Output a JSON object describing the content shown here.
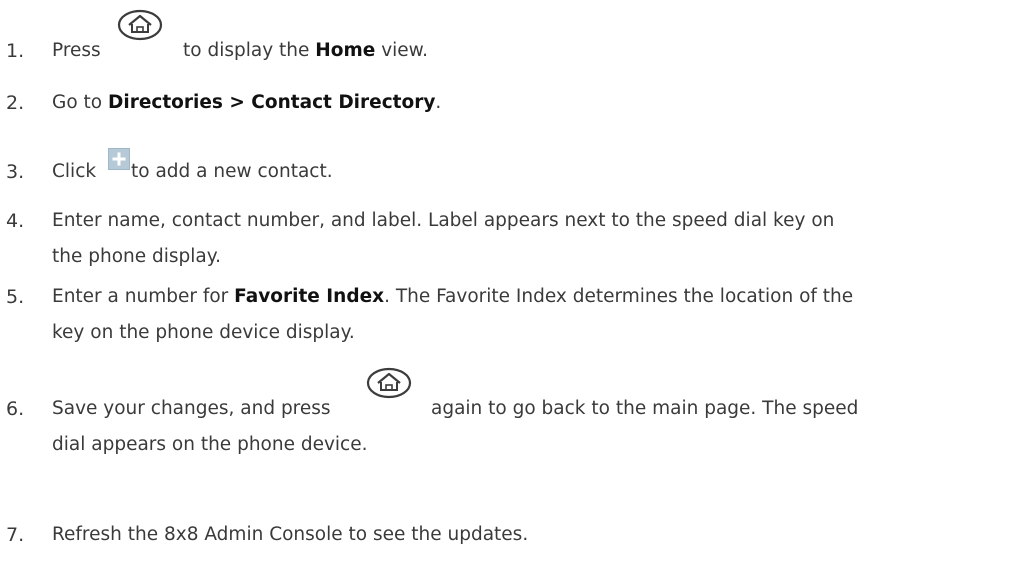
{
  "steps": [
    {
      "number": "1.",
      "pre": "Press",
      "post": "to display the",
      "bold": "Home",
      "tail": "view."
    },
    {
      "number": "2.",
      "pre": "Go to",
      "bold": "Directories > Contact Directory",
      "tail": "."
    },
    {
      "number": "3.",
      "pre": "Click",
      "post": "to add a new contact."
    },
    {
      "number": "4.",
      "line1": "Enter name, contact number, and label. Label appears next to the speed dial key on",
      "line2": "the phone display."
    },
    {
      "number": "5.",
      "pre": "Enter a number for",
      "bold": "Favorite Index",
      "line1_rest": ". The Favorite Index determines the location of the",
      "line2": "key on the phone device display."
    },
    {
      "number": "6.",
      "pre": "Save your changes, and press",
      "line1_rest": "again to go back to the main page. The speed",
      "line2": "dial appears on the phone device."
    },
    {
      "number": "7.",
      "text": "Refresh the 8x8 Admin Console to see the updates."
    }
  ],
  "icons": {
    "home": "home-icon",
    "add": "plus-icon",
    "accent": "#3c3c3c",
    "plus_color": "#9eb8c8"
  }
}
